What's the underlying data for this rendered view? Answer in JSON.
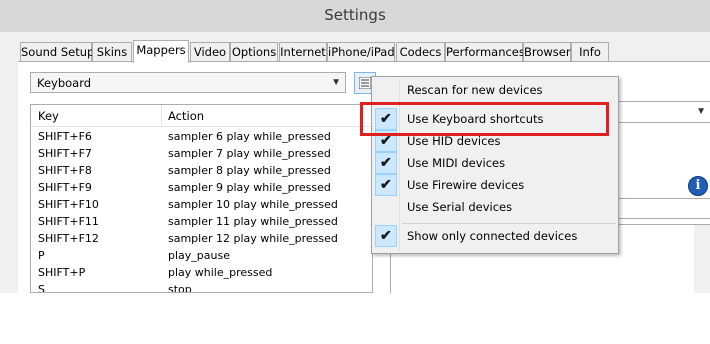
{
  "window": {
    "title": "Settings"
  },
  "tabs": [
    {
      "label": "Sound Setup",
      "active": false
    },
    {
      "label": "Skins",
      "active": false
    },
    {
      "label": "Mappers",
      "active": true
    },
    {
      "label": "Video",
      "active": false
    },
    {
      "label": "Options",
      "active": false
    },
    {
      "label": "Internet",
      "active": false
    },
    {
      "label": "iPhone/iPad",
      "active": false
    },
    {
      "label": "Codecs",
      "active": false
    },
    {
      "label": "Performances",
      "active": false
    },
    {
      "label": "Browser",
      "active": false
    },
    {
      "label": "Info",
      "active": false
    }
  ],
  "device_select": {
    "value": "Keyboard"
  },
  "mapping_list": {
    "columns": [
      "Key",
      "Action"
    ],
    "rows": [
      {
        "key": "SHIFT+F6",
        "action": "sampler 6 play while_pressed"
      },
      {
        "key": "SHIFT+F7",
        "action": "sampler 7 play while_pressed"
      },
      {
        "key": "SHIFT+F8",
        "action": "sampler 8 play while_pressed"
      },
      {
        "key": "SHIFT+F9",
        "action": "sampler 9 play while_pressed"
      },
      {
        "key": "SHIFT+F10",
        "action": "sampler 10 play while_pressed"
      },
      {
        "key": "SHIFT+F11",
        "action": "sampler 11 play while_pressed"
      },
      {
        "key": "SHIFT+F12",
        "action": "sampler 12 play while_pressed"
      },
      {
        "key": "P",
        "action": "play_pause"
      },
      {
        "key": "SHIFT+P",
        "action": "play while_pressed"
      },
      {
        "key": "S",
        "action": "stop"
      }
    ]
  },
  "context_menu": {
    "items": [
      {
        "label": "Rescan for new devices",
        "checked": false
      },
      {
        "label": "Use Keyboard shortcuts",
        "checked": true
      },
      {
        "label": "Use HID devices",
        "checked": true
      },
      {
        "label": "Use MIDI devices",
        "checked": true
      },
      {
        "label": "Use Firewire devices",
        "checked": true
      },
      {
        "label": "Use Serial devices",
        "checked": false
      },
      {
        "label": "Show only connected devices",
        "checked": true
      }
    ]
  },
  "colors": {
    "highlight_border": "#e02020",
    "check_bg": "#cce8ff",
    "info_icon": "#1f5fb8"
  },
  "icons": {
    "menu_button": "list-menu-icon",
    "check": "checkmark-icon",
    "info": "info-icon",
    "dropdown": "chevron-down-icon"
  }
}
